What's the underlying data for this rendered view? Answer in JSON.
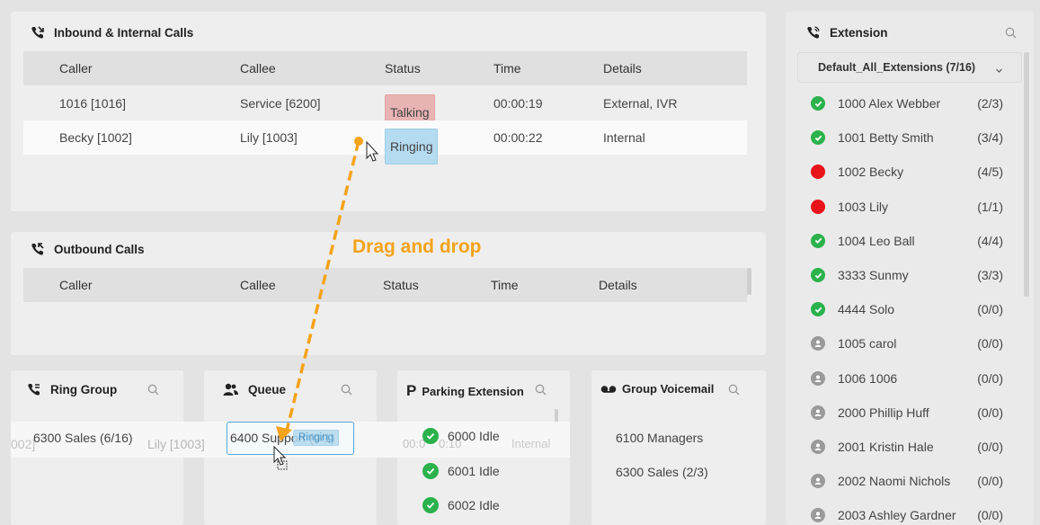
{
  "inbound": {
    "title": "Inbound & Internal Calls",
    "columns": [
      "Caller",
      "Callee",
      "Status",
      "Time",
      "Details"
    ],
    "rows": [
      {
        "caller": "1016 [1016]",
        "callee": "Service [6200]",
        "status": "Talking",
        "time": "00:00:19",
        "details": "External, IVR"
      },
      {
        "caller": "Becky [1002]",
        "callee": "Lily [1003]",
        "status": "Ringing",
        "time": "00:00:22",
        "details": "Internal"
      }
    ]
  },
  "outbound": {
    "title": "Outbound Calls",
    "columns": [
      "Caller",
      "Callee",
      "Status",
      "Time",
      "Details"
    ]
  },
  "annotation": {
    "label": "Drag and drop",
    "color": "#f5a31a"
  },
  "ring_group": {
    "title": "Ring Group",
    "item": "6300 Sales (6/16)"
  },
  "queue": {
    "title": "Queue",
    "item": "6400 Support (0/1)"
  },
  "parking": {
    "title": "Parking Extension",
    "items": [
      "6000 Idle",
      "6001 Idle",
      "6002 Idle"
    ]
  },
  "group_voicemail": {
    "title": "Group Voicemail",
    "items": [
      "6100 Managers",
      "6300 Sales (2/3)"
    ]
  },
  "drag_ghost": {
    "caller_fragment": "002]",
    "callee": "Lily [1003]",
    "status": "Ringing",
    "time_fragment": "00:0",
    "time_tail": "0:10",
    "details": "Internal"
  },
  "extension": {
    "title": "Extension",
    "dropdown": "Default_All_Extensions (7/16)",
    "items": [
      {
        "name": "1000 Alex Webber",
        "count": "(2/3)",
        "state": "available"
      },
      {
        "name": "1001 Betty Smith",
        "count": "(3/4)",
        "state": "available"
      },
      {
        "name": "1002 Becky",
        "count": "(4/5)",
        "state": "busy"
      },
      {
        "name": "1003 Lily",
        "count": "(1/1)",
        "state": "busy"
      },
      {
        "name": "1004 Leo Ball",
        "count": "(4/4)",
        "state": "available"
      },
      {
        "name": "3333 Sunmy",
        "count": "(3/3)",
        "state": "available"
      },
      {
        "name": "4444 Solo",
        "count": "(0/0)",
        "state": "available"
      },
      {
        "name": "1005 carol",
        "count": "(0/0)",
        "state": "offline"
      },
      {
        "name": "1006 1006",
        "count": "(0/0)",
        "state": "offline"
      },
      {
        "name": "2000 Phillip Huff",
        "count": "(0/0)",
        "state": "offline"
      },
      {
        "name": "2001 Kristin Hale",
        "count": "(0/0)",
        "state": "offline"
      },
      {
        "name": "2002 Naomi Nichols",
        "count": "(0/0)",
        "state": "offline"
      },
      {
        "name": "2003 Ashley Gardner",
        "count": "(0/0)",
        "state": "offline"
      }
    ]
  },
  "colors": {
    "available": "#2bb24c",
    "busy": "#e8141a",
    "offline": "#9a9a9a",
    "talking_bg": "#e8b3b3",
    "ringing_bg": "#b4dbf0",
    "accent": "#f5a31a"
  }
}
